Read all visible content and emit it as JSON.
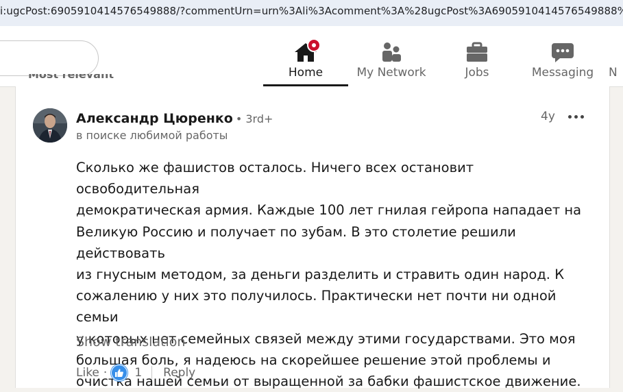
{
  "browser": {
    "url": "i:ugcPost:6905910414576549888/?commentUrn=urn%3Ali%3Acomment%3A%28ugcPost%3A6905910414576549888%"
  },
  "nav": {
    "items": [
      {
        "label": "Home",
        "icon": "home-icon",
        "active": true
      },
      {
        "label": "My Network",
        "icon": "network-icon"
      },
      {
        "label": "Jobs",
        "icon": "briefcase-icon"
      },
      {
        "label": "Messaging",
        "icon": "messaging-icon"
      },
      {
        "label": "N"
      }
    ]
  },
  "sort": {
    "label": "Most relevant"
  },
  "comment": {
    "author": "Александр Цюренко",
    "degree": "• 3rd+",
    "headline": "в поиске любимой работы",
    "time": "4y",
    "lines": [
      "Сколько же фашистов осталось. Ничего всех остановит освободительная",
      "демократическая армия. Каждые 100 лет гнилая гейропа нападает на",
      "Великую Россию и получает по зубам. В это столетие решили действовать",
      "из гнусным методом, за деньги разделить и стравить один народ. К",
      "сожалению у них это получилось. Практически нет почти ни одной семьи",
      "у которых нет семейных связей между этими государствами. Это моя",
      "большая боль, я надеюсь на скорейшее решение этой проблемы и",
      "очистка нашей семьи от выращенной за бабки фашистское движение."
    ],
    "show_translation": "Show translation",
    "like_label": "Like",
    "separator": "·",
    "reaction_count": "1",
    "reply_label": "Reply"
  },
  "colors": {
    "like_blue": "#378fe9",
    "notification_red": "#cb112d"
  }
}
